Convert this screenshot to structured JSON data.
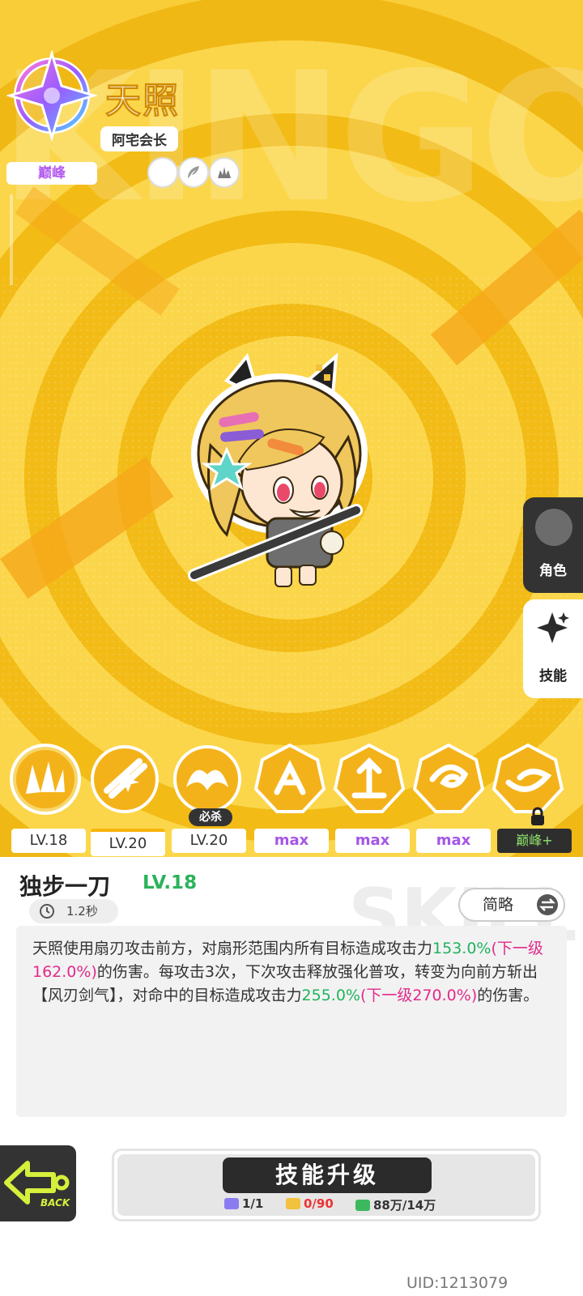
{
  "character": {
    "name": "天照",
    "title": "阿宅会长",
    "rank": "巅峰",
    "background_word": "KINGOD"
  },
  "side_tabs": [
    {
      "label": "角色",
      "icon": "avatar-icon"
    },
    {
      "label": "技能",
      "icon": "sparkle-icon"
    }
  ],
  "skills": {
    "ultimate_tag": "必杀",
    "levels": [
      "LV.18",
      "LV.20",
      "LV.20",
      "max",
      "max",
      "max",
      "巅峰+"
    ]
  },
  "detail": {
    "name": "独步一刀",
    "level": "LV.18",
    "cooldown": "1.2秒",
    "mode_button": "简略",
    "desc": {
      "p1": "天照使用扇刃攻击前方，对扇形范围内所有目标造成攻击力",
      "v1": "153.0%",
      "n1": "(下一级162.0%)",
      "p2": "的伤害。每攻击3次，下次攻击释放强化普攻，转变为向前方斩出【风刃剑气】，对命中的目标造成攻击力",
      "v2": "255.0%",
      "n2": "(下一级270.0%)",
      "p3": "的伤害。"
    }
  },
  "footer": {
    "back_label": "BACK",
    "upgrade_label": "技能升级",
    "costs": [
      {
        "value": "1/1",
        "icon": "book-icon",
        "color": "#8a7cf0"
      },
      {
        "value": "0/90",
        "icon": "ticket-icon",
        "color": "#f2c13d"
      },
      {
        "value": "88万/14万",
        "icon": "cash-icon",
        "color": "#3cb95e"
      }
    ],
    "uid": "UID:1213079"
  },
  "colors": {
    "accent_yellow": "#f4c21c",
    "green": "#20b35d",
    "magenta": "#e22a8c",
    "purple": "#a556e6"
  }
}
